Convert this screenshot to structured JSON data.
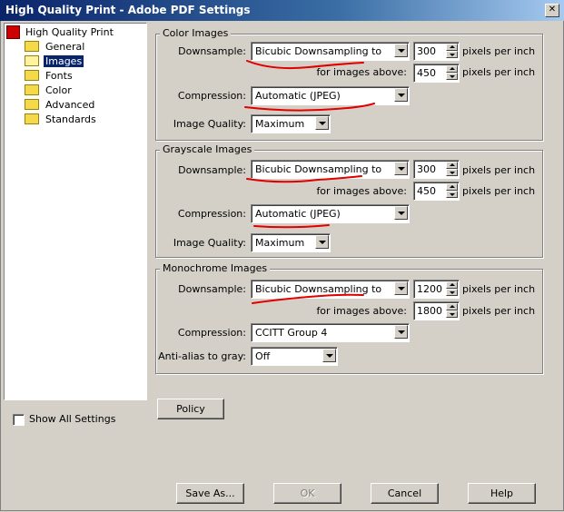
{
  "window": {
    "title": "High Quality Print - Adobe PDF Settings",
    "close_glyph": "✕"
  },
  "tree": {
    "root": "High Quality Print",
    "items": [
      {
        "label": "General",
        "selected": false
      },
      {
        "label": "Images",
        "selected": true
      },
      {
        "label": "Fonts",
        "selected": false
      },
      {
        "label": "Color",
        "selected": false
      },
      {
        "label": "Advanced",
        "selected": false
      },
      {
        "label": "Standards",
        "selected": false
      }
    ]
  },
  "labels": {
    "downsample": "Downsample:",
    "for_images_above": "for images above:",
    "compression": "Compression:",
    "image_quality": "Image Quality:",
    "anti_alias": "Anti-alias to gray:",
    "ppi": "pixels per inch"
  },
  "color_images": {
    "legend": "Color Images",
    "downsample": "Bicubic Downsampling to",
    "resolution": "300",
    "above": "450",
    "compression": "Automatic (JPEG)",
    "quality": "Maximum"
  },
  "grayscale_images": {
    "legend": "Grayscale Images",
    "downsample": "Bicubic Downsampling to",
    "resolution": "300",
    "above": "450",
    "compression": "Automatic (JPEG)",
    "quality": "Maximum"
  },
  "monochrome_images": {
    "legend": "Monochrome Images",
    "downsample": "Bicubic Downsampling to",
    "resolution": "1200",
    "above": "1800",
    "compression": "CCITT Group 4",
    "anti_alias": "Off"
  },
  "policy_label": "Policy",
  "show_all_settings": {
    "label": "Show All Settings",
    "checked": false
  },
  "buttons": {
    "save_as": "Save As...",
    "ok": "OK",
    "cancel": "Cancel",
    "help": "Help"
  },
  "annotation_color": "#e00000"
}
